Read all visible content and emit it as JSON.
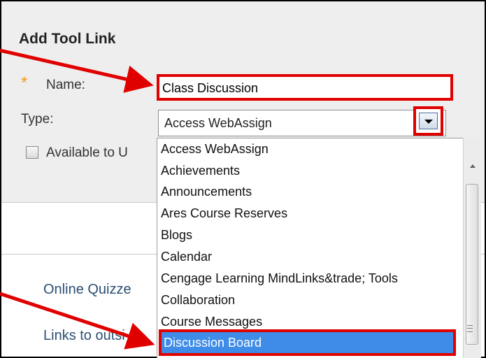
{
  "dialog": {
    "title": "Add Tool Link",
    "required_mark": "*",
    "name_label": "Name:",
    "name_value": "Class Discussion",
    "type_label": "Type:",
    "type_selected": "Access WebAssign",
    "available_label": "Available to U"
  },
  "background_links": [
    "Online Quizze",
    "Links to outsi"
  ],
  "dropdown": {
    "options": [
      "Access WebAssign",
      "Achievements",
      "Announcements",
      "Ares Course Reserves",
      "Blogs",
      "Calendar",
      "Cengage Learning MindLinks&trade; Tools",
      "Collaboration",
      "Course Messages",
      "Discussion Board"
    ],
    "highlighted": "Discussion Board"
  },
  "colors": {
    "highlight_border": "#e00000",
    "selected_option_bg": "#3f8ce8",
    "required_star": "#f39a1a",
    "link_text": "#2a4f72"
  }
}
